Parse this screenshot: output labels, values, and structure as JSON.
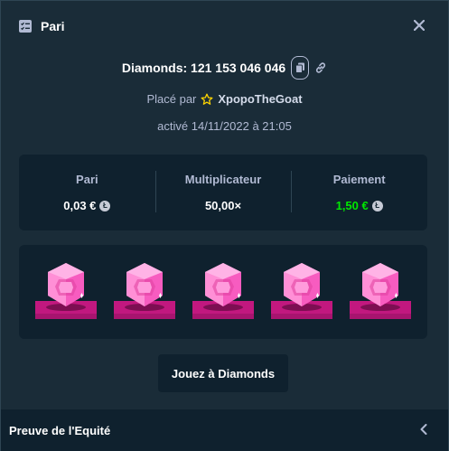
{
  "header": {
    "title": "Pari",
    "icon": "bet-slip-icon",
    "close_icon": "close-icon"
  },
  "game": {
    "name": "Diamonds",
    "bet_id": "121 153 046 046",
    "label": "Diamonds: 121 153 046 046",
    "copy_icon": "copy-icon",
    "link_icon": "link-icon"
  },
  "placed": {
    "prefix": "Placé par",
    "user": "XpopoTheGoat",
    "user_icon": "star-icon"
  },
  "activated": {
    "text": "activé 14/11/2022 à 21:05"
  },
  "stats": {
    "bet": {
      "label": "Pari",
      "value": "0,03 €"
    },
    "multiplier": {
      "label": "Multiplicateur",
      "value": "50,00×"
    },
    "payout": {
      "label": "Paiement",
      "value": "1,50 €"
    },
    "coin_icon": "litecoin-icon"
  },
  "result": {
    "gems": [
      "pink",
      "pink",
      "pink",
      "pink",
      "pink"
    ]
  },
  "play_button": {
    "label": "Jouez à Diamonds"
  },
  "footer": {
    "label": "Preuve de l'Equité",
    "icon": "chevron-left-icon"
  },
  "colors": {
    "background": "#1a2c38",
    "panel": "#0f212e",
    "muted_text": "#b1bad3",
    "payout_green": "#00e701",
    "gem_pink": "#f75cc0",
    "star_yellow": "#ffd500"
  }
}
